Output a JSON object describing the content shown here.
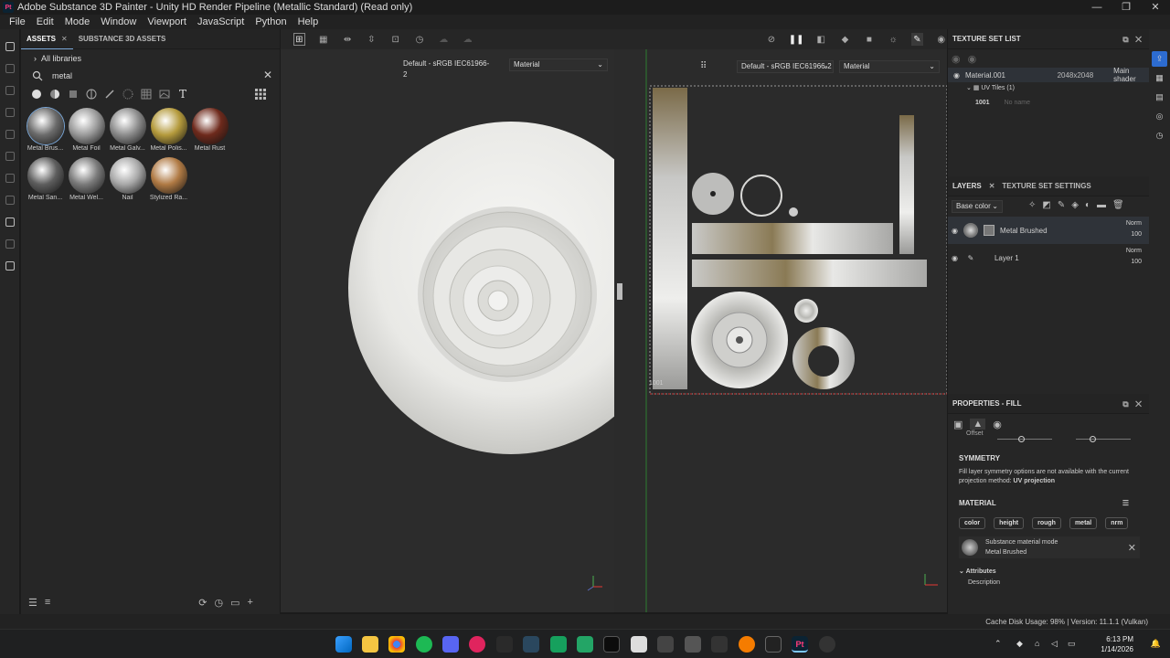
{
  "window": {
    "logo": "Pt",
    "title": "Adobe Substance 3D Painter - Unity HD Render Pipeline (Metallic Standard) (Read only)",
    "controls": [
      "—",
      "❐",
      "✕"
    ]
  },
  "menu": [
    "File",
    "Edit",
    "Mode",
    "Window",
    "Viewport",
    "JavaScript",
    "Python",
    "Help"
  ],
  "assets": {
    "tabs": [
      {
        "label": "ASSETS",
        "close": "✕"
      },
      {
        "label": "SUBSTANCE 3D ASSETS"
      }
    ],
    "library": "All libraries",
    "search_value": "metal",
    "clear": "✕",
    "filter_text": "T",
    "materials": [
      {
        "label": "Metal Brus...",
        "color": "#6b6b6b"
      },
      {
        "label": "Metal Foil",
        "color": "#9a9a9a"
      },
      {
        "label": "Metal Galv...",
        "color": "#8c8c8c"
      },
      {
        "label": "Metal Polis...",
        "color": "#b49a3c"
      },
      {
        "label": "Metal Rust",
        "color": "#6e2a1c"
      },
      {
        "label": "Metal San...",
        "color": "#5e5e5e"
      },
      {
        "label": "Metal Wel...",
        "color": "#7a7a7a"
      },
      {
        "label": "Nail",
        "color": "#a8a8a8"
      },
      {
        "label": "Stylized Ra...",
        "color": "#b07a44"
      }
    ]
  },
  "viewport": {
    "left_color_profile": "Default - sRGB IEC61966-2",
    "left_channel": "Material",
    "right_color_profile": "Default - sRGB IEC61966-2",
    "right_channel": "Material",
    "uv_tile_label": "1001"
  },
  "texture_set_list": {
    "title": "TEXTURE SET LIST",
    "set_name": "Material.001",
    "resolution": "2048x2048",
    "shader": "Main shader",
    "uv_tiles": "UV Tiles (1)",
    "tile_id": "1001",
    "tile_name": "No name"
  },
  "layers_panel": {
    "tabs": [
      "LAYERS",
      "TEXTURE SET SETTINGS"
    ],
    "channel": "Base color",
    "layers": [
      {
        "name": "Metal Brushed",
        "blend": "Norm",
        "opacity": "100"
      },
      {
        "name": "Layer 1",
        "blend": "Norm",
        "opacity": "100"
      }
    ]
  },
  "properties": {
    "title": "PROPERTIES - FILL",
    "offset_label": "Offset",
    "symmetry_title": "SYMMETRY",
    "symmetry_text": "Fill layer symmetry options are not available with the current projection method:",
    "symmetry_method": "UV projection",
    "material_title": "MATERIAL",
    "channels": [
      "color",
      "height",
      "rough",
      "metal",
      "nrm"
    ],
    "mode_label": "Substance material mode",
    "mode_value": "Metal Brushed",
    "attributes": "Attributes",
    "description": "Description"
  },
  "status": {
    "text": "Cache Disk Usage:  98% | Version: 11.1.1 (Vulkan)"
  },
  "taskbar": {
    "time": "6:13 PM",
    "date": "1/14/2026"
  }
}
